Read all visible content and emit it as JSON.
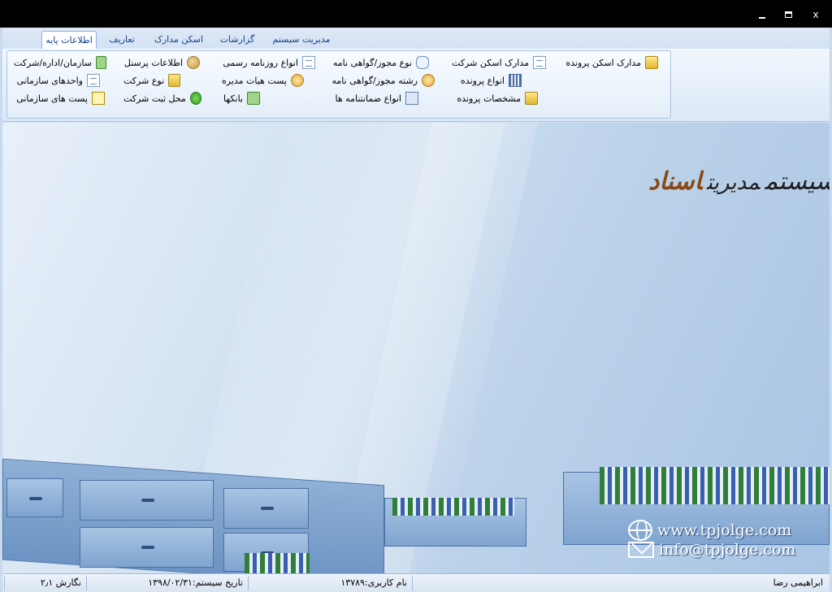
{
  "window": {
    "minimize_icon": "minimize-icon",
    "maximize_icon": "maximize-icon",
    "close_label": "x"
  },
  "tabs": [
    {
      "label": "اطلاعات پایه",
      "active": true
    },
    {
      "label": "تعاریف"
    },
    {
      "label": "اسکن مدارک"
    },
    {
      "label": "گزارشات"
    },
    {
      "label": "مدیریت سیستم"
    }
  ],
  "ribbon": {
    "col1": [
      {
        "label": "مدارک اسکن پرونده",
        "icon": "folder-icon"
      },
      {
        "label": "",
        "icon": ""
      },
      {
        "label": "",
        "icon": ""
      }
    ],
    "col2": [
      {
        "label": "مدارک اسکن شرکت",
        "icon": "scan-doc-icon"
      },
      {
        "label": "انواع پرونده",
        "icon": "binder-icon"
      },
      {
        "label": "مشخصات پرونده",
        "icon": "folder-open-icon"
      }
    ],
    "col3": [
      {
        "label": "نوع مجوز/گواهی نامه",
        "icon": "speech-bubble-icon"
      },
      {
        "label": "رشته مجوز/گواهی نامه",
        "icon": "certificate-icon"
      },
      {
        "label": "انواع ضمانتنامه ها",
        "icon": "network-icon"
      }
    ],
    "col4": [
      {
        "label": "انواع روزنامه رسمی",
        "icon": "newspaper-icon"
      },
      {
        "label": "پست هیات مدیره",
        "icon": "coins-icon"
      },
      {
        "label": "بانکها",
        "icon": "bank-doc-icon"
      }
    ],
    "col5": [
      {
        "label": "اطلاعات پرسنل",
        "icon": "personnel-icon"
      },
      {
        "label": "نوع شرکت",
        "icon": "company-folder-icon"
      },
      {
        "label": "محل ثبت شرکت",
        "icon": "check-icon"
      }
    ],
    "col6": [
      {
        "label": "سازمان/اداره/شرکت",
        "icon": "organization-icon"
      },
      {
        "label": "واحدهای سازمانی",
        "icon": "units-icon"
      },
      {
        "label": "پست های سازمانی",
        "icon": "posts-icon"
      }
    ]
  },
  "logo": {
    "word1": "سیستم",
    "word2": "مدیریت",
    "word3": "اسناد"
  },
  "contact": {
    "website": "www.tpjolge.com",
    "email": "info@tpjolge.com"
  },
  "status": {
    "user_fullname": "ابراهیمی رضا",
    "username": "نام کاربری:۱۳۷۸۹",
    "system_date": "تاریخ سیستم:۱۳۹۸/۰۲/۳۱",
    "version": "نگارش ۲٫۱"
  }
}
